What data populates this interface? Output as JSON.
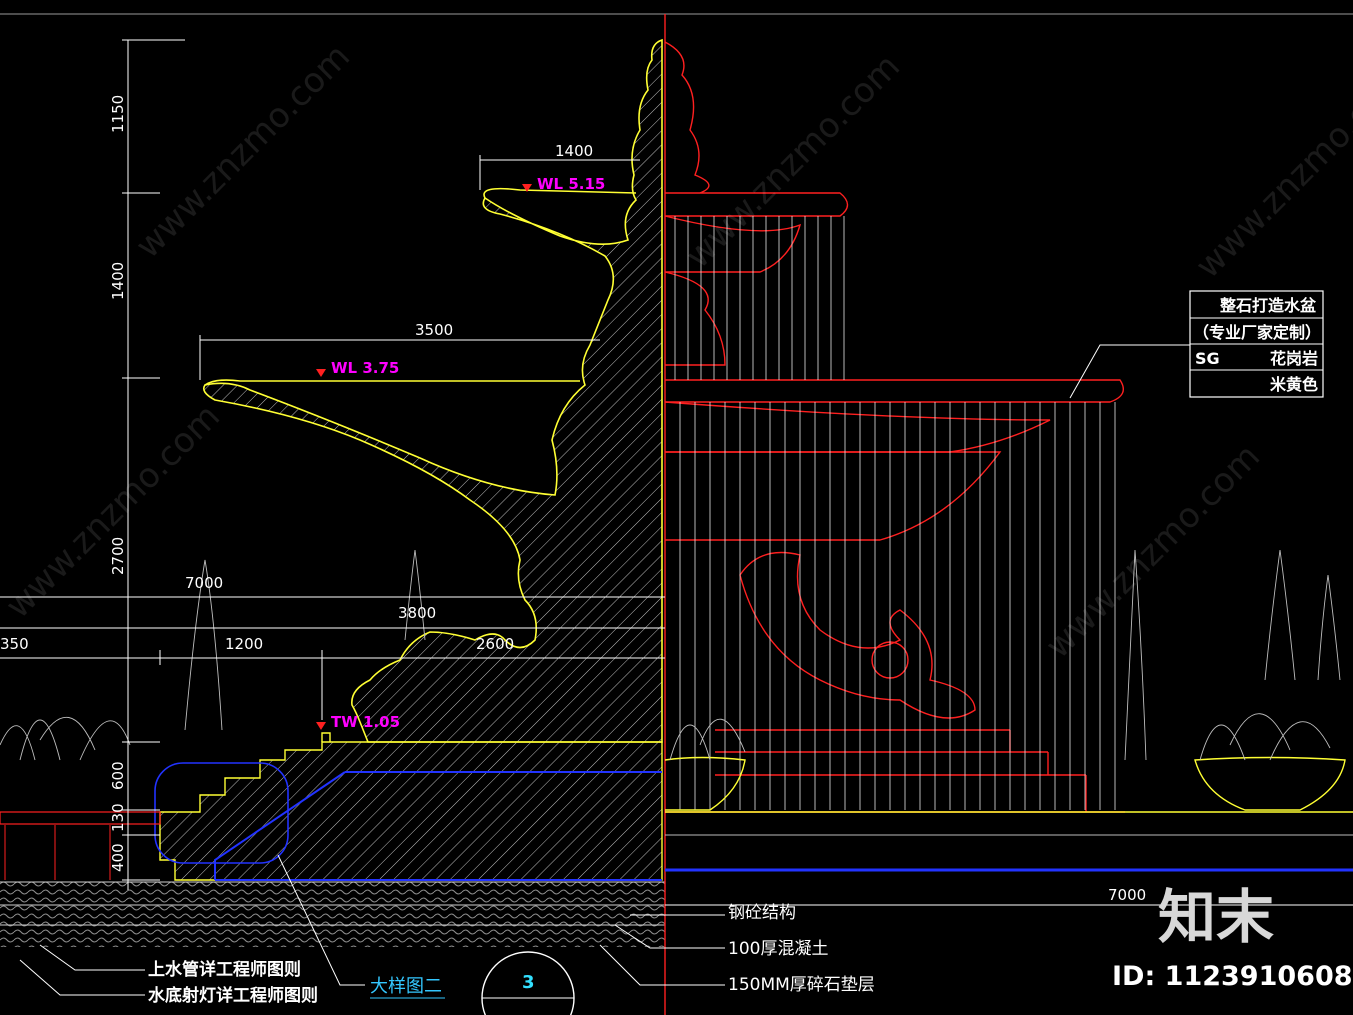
{
  "dimensions_vertical": [
    {
      "label": "1150"
    },
    {
      "label": "1400"
    },
    {
      "label": "2700"
    },
    {
      "label": "600"
    },
    {
      "label": "130"
    },
    {
      "label": "400"
    }
  ],
  "dimensions_horizontal": [
    {
      "label": "1400"
    },
    {
      "label": "3500"
    },
    {
      "label": "7000"
    },
    {
      "label": "350"
    },
    {
      "label": "1200"
    },
    {
      "label": "3800"
    },
    {
      "label": "2600"
    },
    {
      "label": "7000"
    }
  ],
  "levels": [
    {
      "label": "WL 5.15"
    },
    {
      "label": "WL 3.75"
    },
    {
      "label": "TW 1.05"
    }
  ],
  "legend": {
    "row1": "整石打造水盆",
    "row2": "（专业厂家定制）",
    "row3_code": "SG",
    "row3_material": "花岗岩",
    "row4_color": "米黄色"
  },
  "layer_notes": [
    "钢砼结构",
    "100厚混凝土",
    "150MM厚碎石垫层"
  ],
  "engineer_notes": [
    "上水管详工程师图则",
    "水底射灯详工程师图则"
  ],
  "detail_label": "大样图二",
  "detail_number": "3",
  "watermark_text": "www.znzmo.com",
  "brand": {
    "name": "知末",
    "id": "ID: 1123910608"
  },
  "colors": {
    "background": "#000000",
    "section_outline": "#ffff33",
    "elevation_lines": "#ff2020",
    "dimension_lines": "#ffffff",
    "level_text": "#ff00ff",
    "water_lines": "#1a33ff",
    "detail_text": "#33c7ff"
  }
}
